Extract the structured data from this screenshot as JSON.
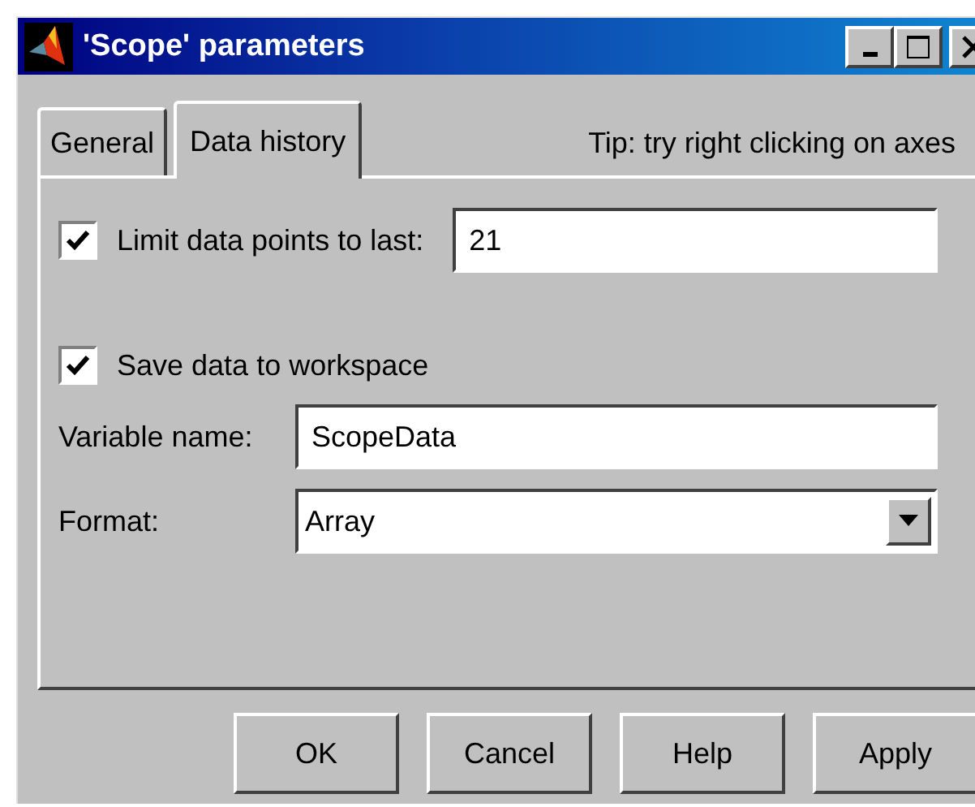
{
  "window": {
    "title": "'Scope' parameters"
  },
  "tabs": [
    {
      "label": "General",
      "selected": false
    },
    {
      "label": "Data history",
      "selected": true
    }
  ],
  "tip": "Tip:  try right clicking on axes",
  "limit": {
    "label": "Limit data points to last:",
    "checked": true,
    "value": "21"
  },
  "save": {
    "label": "Save data to workspace",
    "checked": true
  },
  "variable": {
    "label": "Variable name:",
    "value": "ScopeData"
  },
  "format": {
    "label": "Format:",
    "value": "Array"
  },
  "buttons": [
    "OK",
    "Cancel",
    "Help",
    "Apply"
  ]
}
